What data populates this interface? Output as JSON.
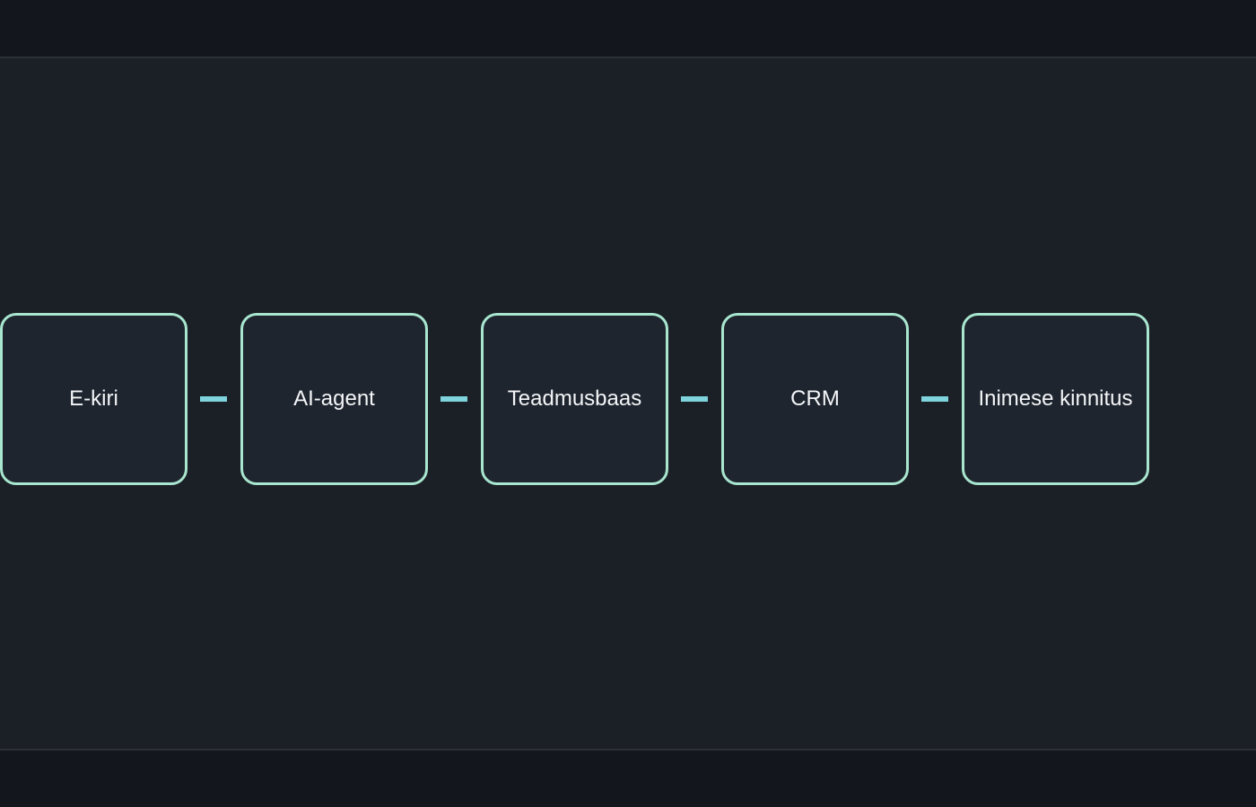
{
  "colors": {
    "node_border": "#a8e6cf",
    "connector": "#7fd3dc",
    "background": "#1b1f26",
    "node_fill": "#1f252e",
    "text": "#f3f5f8"
  },
  "flow": {
    "nodes": [
      {
        "label": "E-kiri"
      },
      {
        "label": "AI-agent"
      },
      {
        "label": "Teadmusbaas"
      },
      {
        "label": "CRM"
      },
      {
        "label": "Inimese kinnitus"
      }
    ]
  }
}
